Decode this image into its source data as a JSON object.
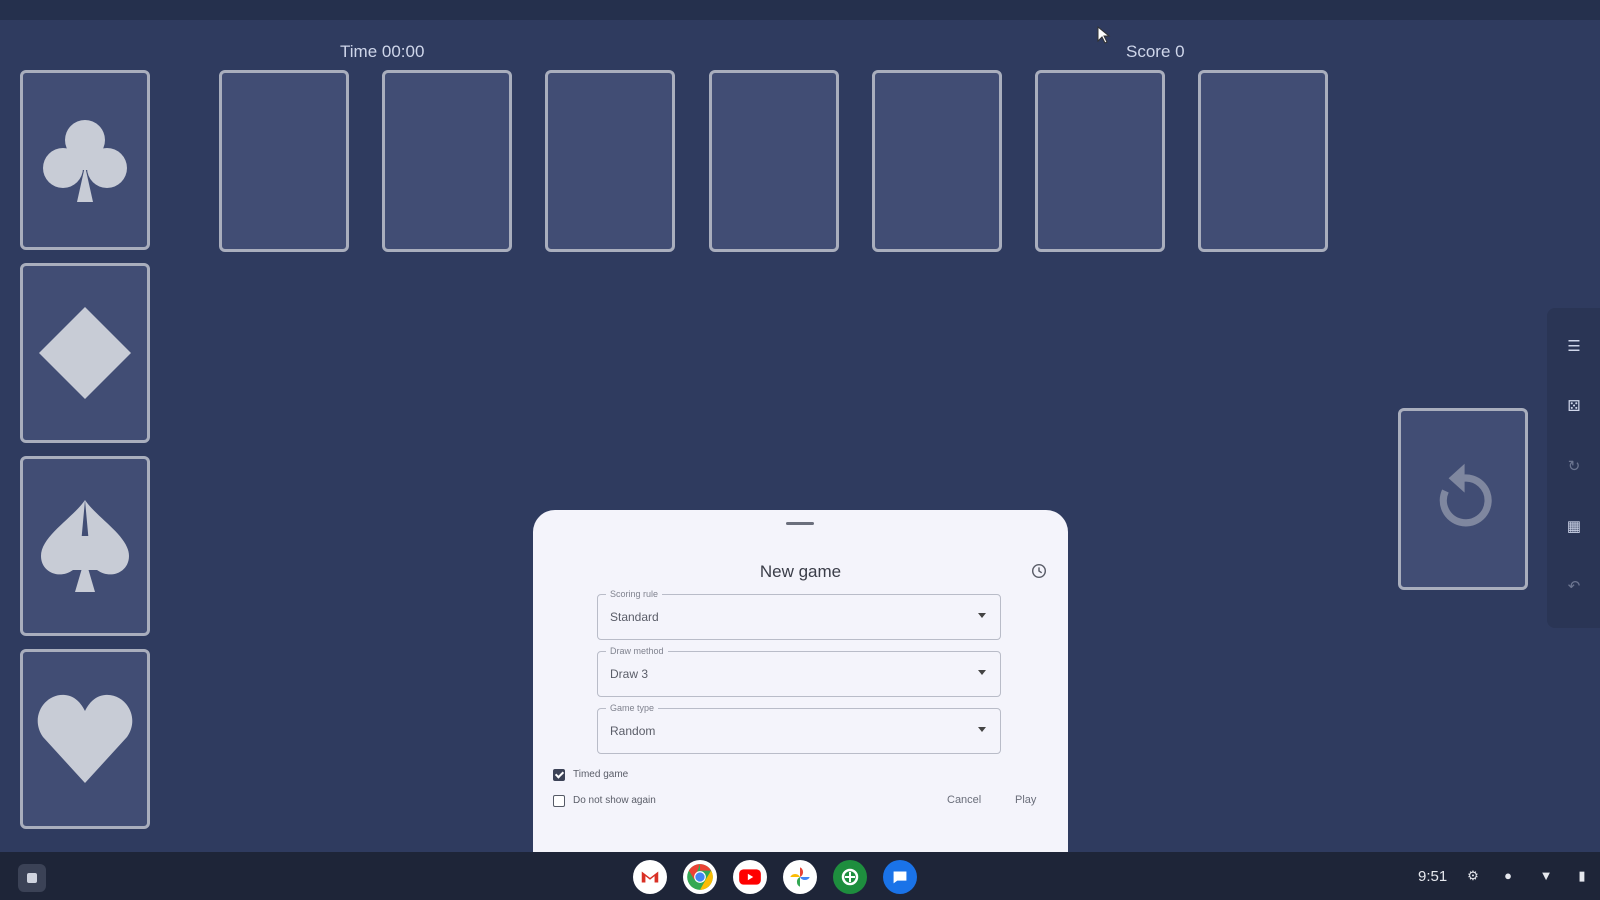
{
  "hud": {
    "time": "Time 00:00",
    "score": "Score 0"
  },
  "foundations": [
    {
      "suit": "club",
      "icon": "club-icon"
    },
    {
      "suit": "diamond",
      "icon": "diamond-icon"
    },
    {
      "suit": "spade",
      "icon": "spade-icon"
    },
    {
      "suit": "heart",
      "icon": "heart-icon"
    }
  ],
  "tableau_count": 7,
  "stock": {
    "icon": "redeal-icon"
  },
  "side_menu": [
    {
      "icon": "menu-icon"
    },
    {
      "icon": "hint-icon"
    },
    {
      "icon": "restart-icon"
    },
    {
      "icon": "stats-icon"
    },
    {
      "icon": "undo-icon"
    }
  ],
  "dialog": {
    "title": "New game",
    "history_icon": "history-icon",
    "scoring": {
      "label": "Scoring rule",
      "value": "Standard"
    },
    "draw": {
      "label": "Draw method",
      "value": "Draw 3"
    },
    "game_type": {
      "label": "Game type",
      "value": "Random"
    },
    "timed_label": "Timed game",
    "timed_checked": true,
    "dont_show_label": "Do not show again",
    "dont_show_checked": false,
    "cancel_label": "Cancel",
    "play_label": "Play"
  },
  "shelf": {
    "apps": [
      {
        "name": "Gmail",
        "icon": "gmail-icon"
      },
      {
        "name": "Chrome",
        "icon": "chrome-icon"
      },
      {
        "name": "YouTube",
        "icon": "youtube-icon"
      },
      {
        "name": "Photos",
        "icon": "photos-icon"
      },
      {
        "name": "Play Games",
        "icon": "play-games-icon"
      },
      {
        "name": "Messages",
        "icon": "messages-icon"
      }
    ],
    "time": "9:51"
  },
  "colors": {
    "background": "#2f3b5f",
    "slot_border": "#a9aebd",
    "slot_fill": "#414d74",
    "sheet": "#f4f4fb"
  }
}
